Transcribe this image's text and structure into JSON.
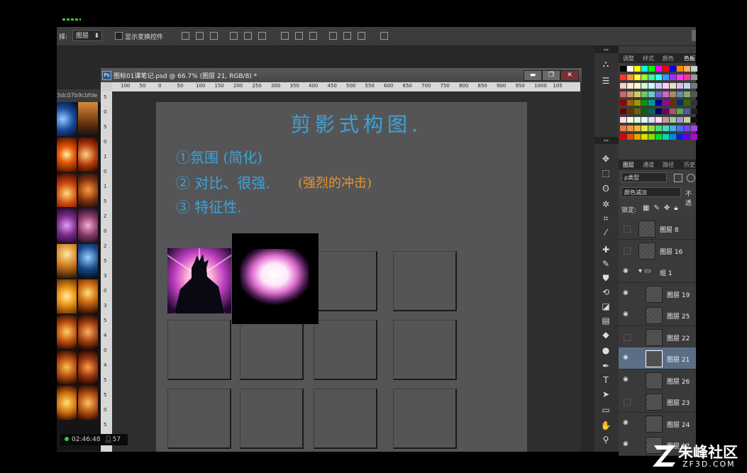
{
  "option_bar": {
    "select_label": "择:",
    "select_value": "图层",
    "show_transform_label": "显示变换控件"
  },
  "thumbs_panel": {
    "tab_label": "3dc07b9cbfde"
  },
  "document": {
    "title": "图标01课笔记.psd @ 66.7% (图层 21, RGB/8) *",
    "ps_icon": "Ps",
    "min_label": "▬",
    "max_label": "❐",
    "close_label": "✕",
    "ruler_top": [
      "100",
      "50",
      "0",
      "50",
      "100",
      "150",
      "200",
      "250",
      "300",
      "350",
      "400",
      "450",
      "500",
      "550",
      "600",
      "650",
      "700",
      "750",
      "800",
      "850",
      "900",
      "950",
      "1000",
      "105"
    ],
    "ruler_left": [
      "5",
      "0",
      "5",
      "0",
      "1",
      "0",
      "1",
      "5",
      "2",
      "0",
      "2",
      "5",
      "3",
      "0",
      "3",
      "5",
      "4",
      "0",
      "4",
      "5",
      "5",
      "0",
      "5",
      "5"
    ]
  },
  "notes": {
    "heading": "剪影式构图.",
    "line1": "①氛围 (简化)",
    "line2_a": "② 对比、很强.",
    "line2_b": "(强烈的冲击)",
    "line3": "③ 特征性."
  },
  "right_panel": {
    "top_tabs": [
      "调整",
      "样式",
      "颜色",
      "色板"
    ],
    "layer_tabs": [
      "图层",
      "通道",
      "路径",
      "历史"
    ],
    "filter_kind": "ρ类型",
    "blend_mode": "颜色减淡",
    "opacity_label": "不透",
    "lock_label": "锁定:",
    "layers": [
      {
        "name": "图层 8",
        "visible": false
      },
      {
        "name": "图层 16",
        "visible": false
      },
      {
        "name": "组 1",
        "visible": true
      },
      {
        "name": "图层 19",
        "visible": true
      },
      {
        "name": "图层 25",
        "visible": true
      },
      {
        "name": "图层 22",
        "visible": false
      },
      {
        "name": "图层 21",
        "visible": true
      },
      {
        "name": "图层 26",
        "visible": true
      },
      {
        "name": "图层 23",
        "visible": false
      },
      {
        "name": "图层 24",
        "visible": true
      },
      {
        "name": "图层 17",
        "visible": true
      }
    ]
  },
  "status": {
    "time": "02:46:48",
    "viewers": "57"
  },
  "watermark": {
    "brand": "朱峰社区",
    "url": "ZF3D.COM"
  }
}
